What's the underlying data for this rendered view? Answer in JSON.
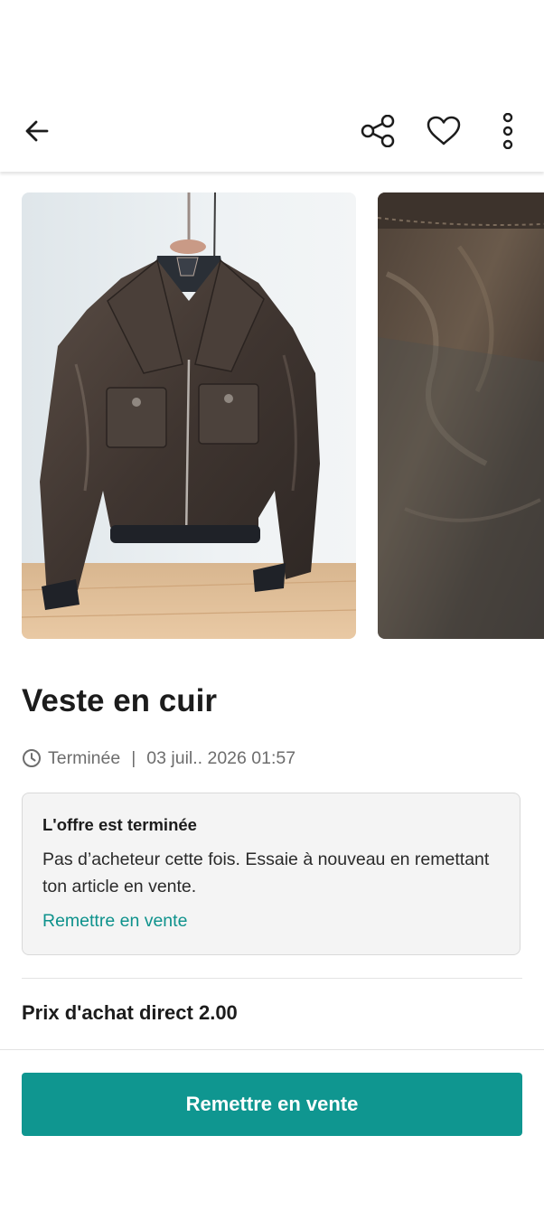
{
  "header": {
    "back_icon": "arrow-left-icon",
    "share_icon": "share-icon",
    "favorite_icon": "heart-icon",
    "more_icon": "more-vertical-icon"
  },
  "gallery": {
    "photos": [
      {
        "name": "leather-jacket-on-hanger-photo"
      },
      {
        "name": "leather-texture-closeup-photo"
      }
    ]
  },
  "item": {
    "title": "Veste en cuir",
    "status": "Terminée",
    "separator": "|",
    "end_date": "03 juil.. 2026 01:57"
  },
  "notice": {
    "title": "L'offre est terminée",
    "body": "Pas d’acheteur cette fois. Essaie à nouveau en remettant ton article en vente.",
    "link": "Remettre en vente"
  },
  "price": {
    "label": "Prix d'achat direct 2.00"
  },
  "cta": {
    "label": "Remettre en vente"
  },
  "colors": {
    "accent": "#0f9690",
    "link": "#0e928c",
    "text": "#1c1c1c",
    "muted": "#6d6d6d"
  }
}
